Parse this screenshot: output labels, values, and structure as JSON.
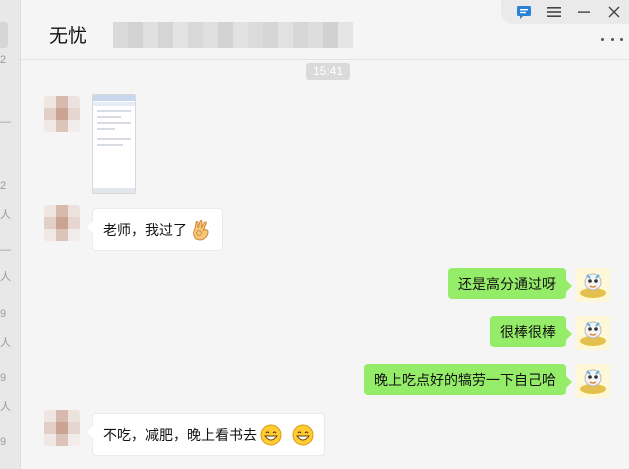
{
  "header": {
    "title": "无忧"
  },
  "window_controls": [
    {
      "name": "compose-icon"
    },
    {
      "name": "menu-icon"
    },
    {
      "name": "minimize-icon"
    },
    {
      "name": "close-icon"
    }
  ],
  "left_strip_fragments": [
    "2",
    "—",
    "2",
    "人",
    "—",
    "人",
    "9",
    "人",
    "9",
    "人",
    "9"
  ],
  "messages": {
    "time_divider": "15:41",
    "incoming_1": {
      "type": "image"
    },
    "incoming_2": {
      "text": "老师，我过了",
      "emoji": "ok-hand-icon"
    },
    "outgoing_1": {
      "text": "还是高分通过呀"
    },
    "outgoing_2": {
      "text": "很棒很棒"
    },
    "outgoing_3": {
      "text": "晚上吃点好的犒劳一下自己哈"
    },
    "incoming_3": {
      "text": "不吃，减肥，晚上看书去",
      "emojis": [
        "grin-icon",
        "grin-icon"
      ]
    }
  },
  "colors": {
    "outgoing_bubble": "#95ec69",
    "incoming_bubble": "#ffffff",
    "background": "#f5f5f5",
    "accent": "#2782d7"
  }
}
